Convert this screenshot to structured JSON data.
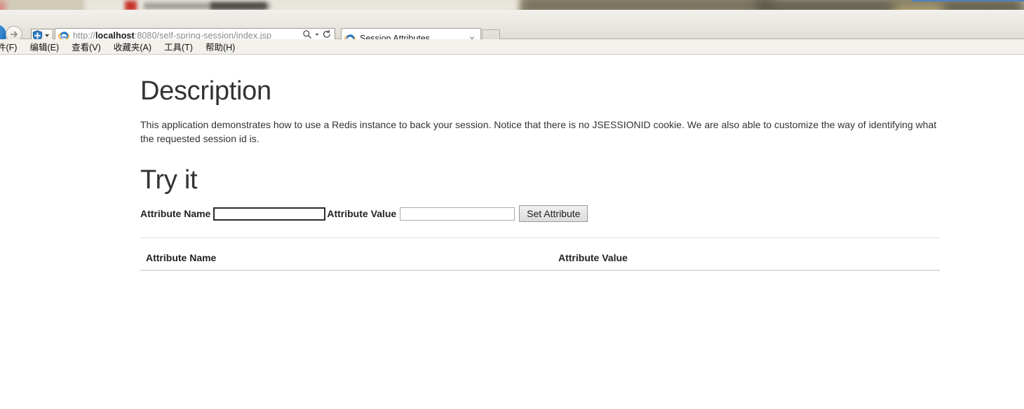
{
  "browser": {
    "back_icon": "back-arrow-icon",
    "forward_icon": "forward-arrow-icon",
    "compat_icon": "compatibility-shield-icon",
    "compat_caret": "chevron-down-icon",
    "address": {
      "scheme": "http://",
      "host": "localhost",
      "path": ":8080/self-spring-session/index.jsp",
      "full_url": "http://localhost:8080/self-spring-session/index.jsp",
      "search_icon": "search-icon",
      "dropdown_icon": "chevron-down-icon",
      "refresh_icon": "refresh-icon"
    },
    "tab": {
      "favicon": "ie-logo-icon",
      "title": "Session Attributes",
      "close_label": "×"
    },
    "new_tab_label": "",
    "menu_items": [
      {
        "label": "件(F)"
      },
      {
        "label": "编辑(E)"
      },
      {
        "label": "查看(V)"
      },
      {
        "label": "收藏夹(A)"
      },
      {
        "label": "工具(T)"
      },
      {
        "label": "帮助(H)"
      }
    ]
  },
  "page": {
    "description_heading": "Description",
    "description_text": "This application demonstrates how to use a Redis instance to back your session. Notice that there is no JSESSIONID cookie. We are also able to customize the way of identifying what the requested session id is.",
    "try_heading": "Try it",
    "form": {
      "attribute_name_label": "Attribute Name",
      "attribute_name_value": "",
      "attribute_name_placeholder": "",
      "attribute_value_label": "Attribute Value",
      "attribute_value_value": "",
      "attribute_value_placeholder": "",
      "submit_label": "Set Attribute"
    },
    "table": {
      "columns": [
        "Attribute Name",
        "Attribute Value"
      ],
      "rows": []
    }
  },
  "colors": {
    "page_background": "#ffffff",
    "text": "#333333",
    "heading": "#333333",
    "chrome_background": "#eae7e1",
    "table_border": "#dddddd",
    "button_face": "#dcdcdc",
    "ie_blue": "#1f6fbe"
  }
}
